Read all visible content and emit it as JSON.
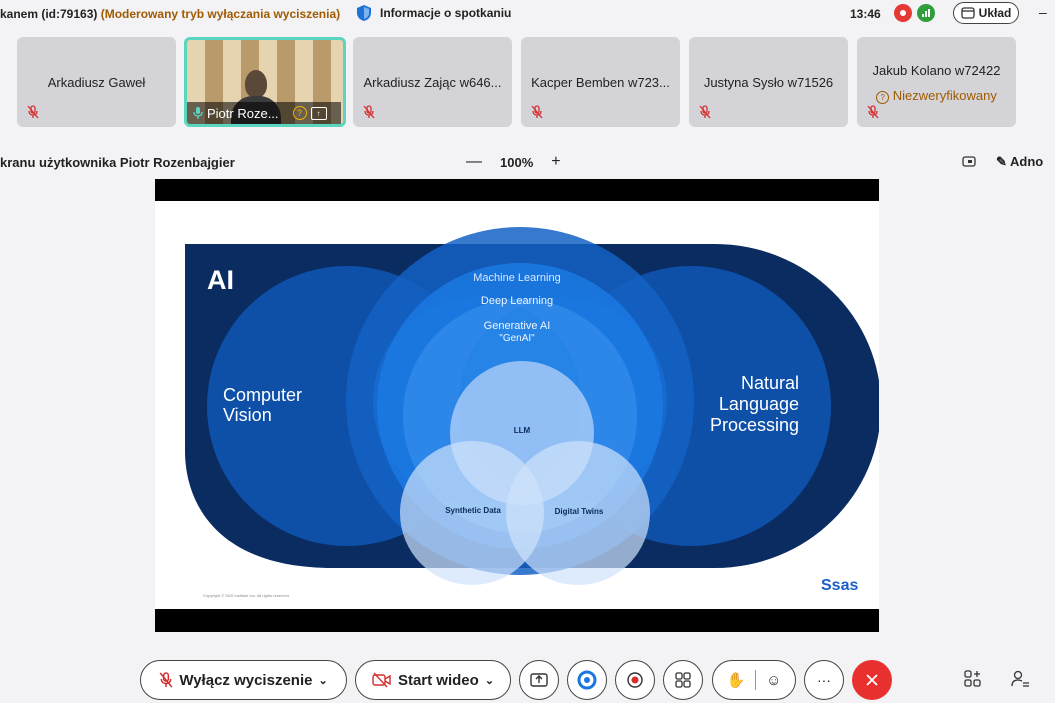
{
  "window": {
    "title_main": "kanem (id:79163)",
    "title_mode": "(Moderowany tryb wyłączania wyciszenia)",
    "meeting_info": "Informacje o spotkaniu",
    "clock": "13:46",
    "layout_label": "Układ"
  },
  "participants": [
    {
      "name": "Arkadiusz Gaweł"
    },
    {
      "name": "Piotr Roze...",
      "video": true
    },
    {
      "name": "Arkadiusz Zając w646..."
    },
    {
      "name": "Kacper Bemben w723..."
    },
    {
      "name": "Justyna Sysło w71526"
    },
    {
      "name": "Jakub Kolano w72422",
      "status": "Niezweryfikowany"
    }
  ],
  "share": {
    "title": "kranu użytkownika Piotr Rozenbajgier",
    "zoom": "100%",
    "annotate_label": "Adno"
  },
  "slide": {
    "ai_label": "AI",
    "computer_vision": [
      "Computer",
      "Vision"
    ],
    "nlp": [
      "Natural",
      "Language",
      "Processing"
    ],
    "machine_learning": "Machine Learning",
    "deep_learning": "Deep Learning",
    "generative_ai": "Generative AI",
    "genai": "\"GenAI\"",
    "llm": "LLM",
    "synthetic_data": "Synthetic Data",
    "digital_twins": "Digital Twins",
    "copyright": "Copyright © SAS Institute Inc. All rights reserved.",
    "logo": "Ssas"
  },
  "controls": {
    "mute_label": "Wyłącz wyciszenie",
    "video_label": "Start wideo"
  },
  "colors": {
    "accent_teal": "#5ad5c0",
    "leave_red": "#e8312f",
    "warning": "#a05a00"
  }
}
